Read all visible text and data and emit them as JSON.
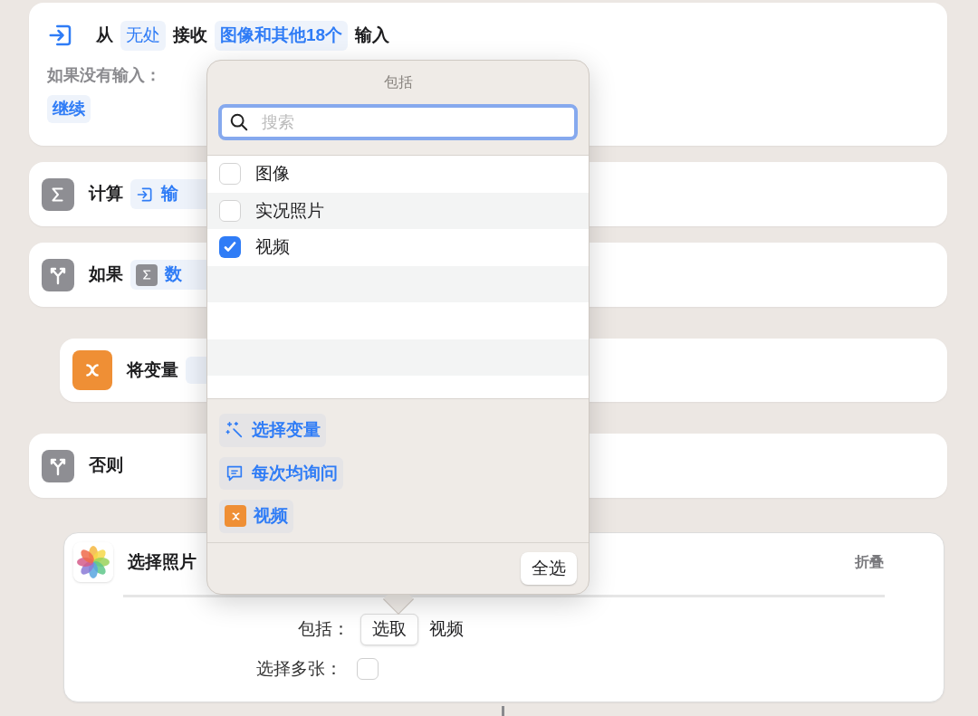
{
  "receive_action": {
    "prefix": "从",
    "source": "无处",
    "verb": "接收",
    "types": "图像和其他18个",
    "suffix": "输入",
    "no_input_label": "如果没有输入：",
    "no_input_value": "继续"
  },
  "calculate_action": {
    "title": "计算",
    "token": "输"
  },
  "if_action": {
    "title": "如果",
    "token": "数"
  },
  "set_variable_action": {
    "title": "将变量"
  },
  "otherwise_action": {
    "title": "否则"
  },
  "select_photos_action": {
    "title": "选择照片",
    "collapse": "折叠",
    "include_label": "包括：",
    "include_button": "选取",
    "include_value": "视频",
    "multiple_label": "选择多张：",
    "multiple_checked": false
  },
  "popover": {
    "title": "包括",
    "search": {
      "placeholder": "搜索"
    },
    "options": [
      {
        "label": "图像",
        "checked": false
      },
      {
        "label": "实况照片",
        "checked": false
      },
      {
        "label": "视频",
        "checked": true
      }
    ],
    "variables": [
      {
        "kind": "magic",
        "label": "选择变量"
      },
      {
        "kind": "ask",
        "label": "每次均询问"
      },
      {
        "kind": "variable",
        "label": "视频"
      }
    ],
    "select_all": "全选"
  }
}
